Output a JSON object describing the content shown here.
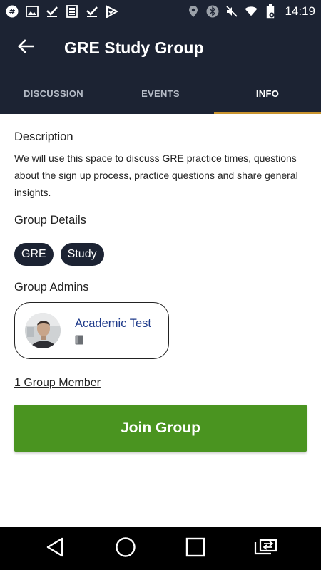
{
  "status_bar": {
    "time": "14:19",
    "left_icons": [
      "hashtag-app-icon",
      "image-icon",
      "check-icon",
      "calculator-icon",
      "check-icon",
      "checkmark-flag-icon"
    ],
    "right_icons": [
      "location-icon",
      "bluetooth-icon",
      "mute-icon",
      "wifi-icon",
      "battery-icon"
    ]
  },
  "app_bar": {
    "title": "GRE Study Group",
    "back_icon": "arrow-left-icon",
    "background": "#1c2333"
  },
  "tabs": [
    {
      "label": "DISCUSSION",
      "active": false
    },
    {
      "label": "EVENTS",
      "active": false
    },
    {
      "label": "INFO",
      "active": true
    }
  ],
  "colors": {
    "accent_underline": "#c9942f",
    "join_button": "#4a9420",
    "admin_link": "#1e3a8a"
  },
  "info": {
    "description_title": "Description",
    "description_text": "We will use this space to discuss GRE practice times, questions about the sign up process, practice questions and share general insights.",
    "details_title": "Group Details",
    "tags": [
      "GRE",
      "Study"
    ],
    "admins_title": "Group Admins",
    "admin": {
      "name": "Academic Test",
      "badge_icon": "book-icon"
    },
    "members_link": "1 Group Member",
    "join_button": "Join Group"
  },
  "nav_bar": {
    "buttons": [
      "back-triangle-icon",
      "home-circle-icon",
      "recents-square-icon",
      "switch-app-icon"
    ]
  }
}
